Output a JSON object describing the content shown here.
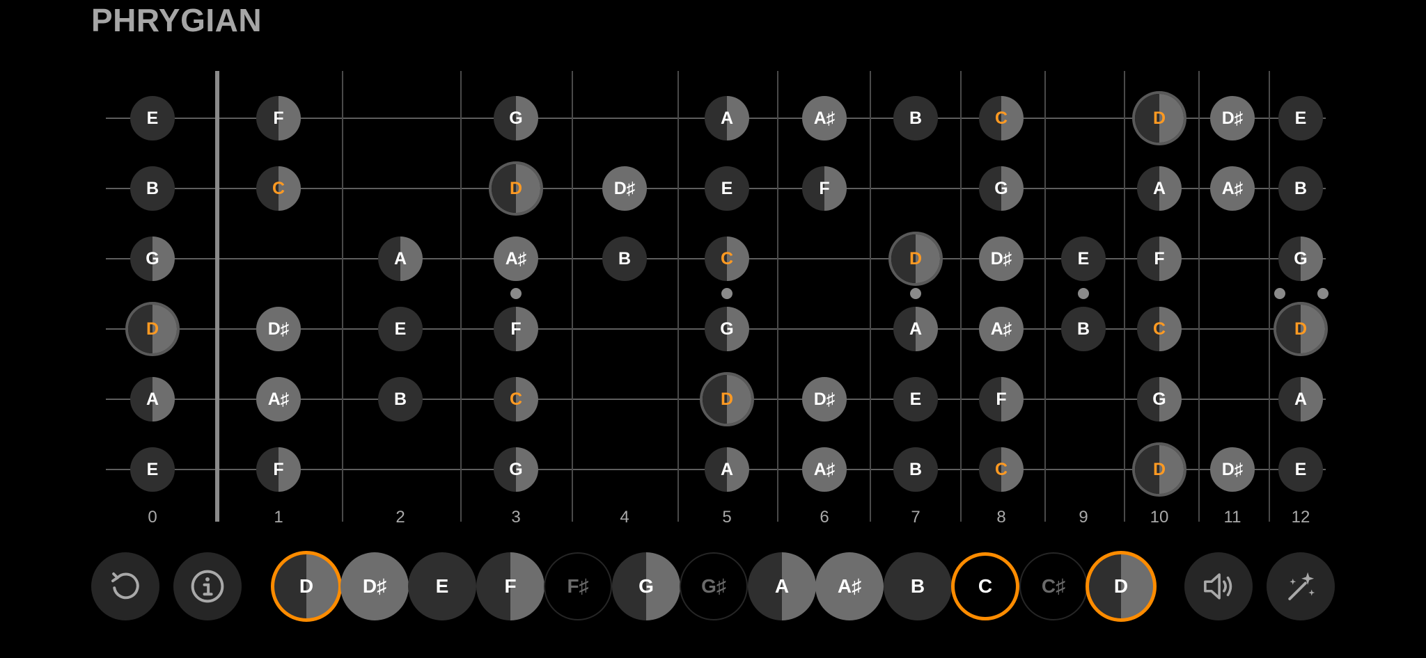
{
  "title": "PHRYGIAN",
  "colors": {
    "dark": "#2f2f2f",
    "light": "#6e6e6e",
    "accent": "#ff9a22",
    "highlight_ring": "#ff8c00"
  },
  "fret_numbers": [
    "0",
    "1",
    "2",
    "3",
    "4",
    "5",
    "6",
    "7",
    "8",
    "9",
    "10",
    "11",
    "12"
  ],
  "strings": [
    {
      "name": "high-e",
      "notes": [
        {
          "fret": 0,
          "label": "E",
          "fill": "dark"
        },
        {
          "fret": 1,
          "label": "F",
          "fill": "half"
        },
        {
          "fret": 3,
          "label": "G",
          "fill": "half"
        },
        {
          "fret": 5,
          "label": "A",
          "fill": "half"
        },
        {
          "fret": 6,
          "label": "A♯",
          "fill": "light"
        },
        {
          "fret": 7,
          "label": "B",
          "fill": "dark"
        },
        {
          "fret": 8,
          "label": "C",
          "fill": "half",
          "accent": true
        },
        {
          "fret": 10,
          "label": "D",
          "fill": "half",
          "accent": true,
          "root": true
        },
        {
          "fret": 11,
          "label": "D♯",
          "fill": "light"
        },
        {
          "fret": 12,
          "label": "E",
          "fill": "dark"
        }
      ]
    },
    {
      "name": "b",
      "notes": [
        {
          "fret": 0,
          "label": "B",
          "fill": "dark"
        },
        {
          "fret": 1,
          "label": "C",
          "fill": "half",
          "accent": true
        },
        {
          "fret": 3,
          "label": "D",
          "fill": "half",
          "accent": true,
          "root": true
        },
        {
          "fret": 4,
          "label": "D♯",
          "fill": "light"
        },
        {
          "fret": 5,
          "label": "E",
          "fill": "dark"
        },
        {
          "fret": 6,
          "label": "F",
          "fill": "half"
        },
        {
          "fret": 8,
          "label": "G",
          "fill": "half"
        },
        {
          "fret": 10,
          "label": "A",
          "fill": "half"
        },
        {
          "fret": 11,
          "label": "A♯",
          "fill": "light"
        },
        {
          "fret": 12,
          "label": "B",
          "fill": "dark"
        }
      ]
    },
    {
      "name": "g",
      "notes": [
        {
          "fret": 0,
          "label": "G",
          "fill": "half"
        },
        {
          "fret": 2,
          "label": "A",
          "fill": "half"
        },
        {
          "fret": 3,
          "label": "A♯",
          "fill": "light"
        },
        {
          "fret": 4,
          "label": "B",
          "fill": "dark"
        },
        {
          "fret": 5,
          "label": "C",
          "fill": "half",
          "accent": true
        },
        {
          "fret": 7,
          "label": "D",
          "fill": "half",
          "accent": true,
          "root": true
        },
        {
          "fret": 8,
          "label": "D♯",
          "fill": "light"
        },
        {
          "fret": 9,
          "label": "E",
          "fill": "dark"
        },
        {
          "fret": 10,
          "label": "F",
          "fill": "half"
        },
        {
          "fret": 12,
          "label": "G",
          "fill": "half"
        }
      ]
    },
    {
      "name": "d",
      "notes": [
        {
          "fret": 0,
          "label": "D",
          "fill": "half",
          "accent": true,
          "root": true
        },
        {
          "fret": 1,
          "label": "D♯",
          "fill": "light"
        },
        {
          "fret": 2,
          "label": "E",
          "fill": "dark"
        },
        {
          "fret": 3,
          "label": "F",
          "fill": "half"
        },
        {
          "fret": 5,
          "label": "G",
          "fill": "half"
        },
        {
          "fret": 7,
          "label": "A",
          "fill": "half"
        },
        {
          "fret": 8,
          "label": "A♯",
          "fill": "light"
        },
        {
          "fret": 9,
          "label": "B",
          "fill": "dark"
        },
        {
          "fret": 10,
          "label": "C",
          "fill": "half",
          "accent": true
        },
        {
          "fret": 12,
          "label": "D",
          "fill": "half",
          "accent": true,
          "root": true
        }
      ]
    },
    {
      "name": "a",
      "notes": [
        {
          "fret": 0,
          "label": "A",
          "fill": "half"
        },
        {
          "fret": 1,
          "label": "A♯",
          "fill": "light"
        },
        {
          "fret": 2,
          "label": "B",
          "fill": "dark"
        },
        {
          "fret": 3,
          "label": "C",
          "fill": "half",
          "accent": true
        },
        {
          "fret": 5,
          "label": "D",
          "fill": "half",
          "accent": true,
          "root": true
        },
        {
          "fret": 6,
          "label": "D♯",
          "fill": "light"
        },
        {
          "fret": 7,
          "label": "E",
          "fill": "dark"
        },
        {
          "fret": 8,
          "label": "F",
          "fill": "half"
        },
        {
          "fret": 10,
          "label": "G",
          "fill": "half"
        },
        {
          "fret": 12,
          "label": "A",
          "fill": "half"
        }
      ]
    },
    {
      "name": "low-e",
      "notes": [
        {
          "fret": 0,
          "label": "E",
          "fill": "dark"
        },
        {
          "fret": 1,
          "label": "F",
          "fill": "half"
        },
        {
          "fret": 3,
          "label": "G",
          "fill": "half"
        },
        {
          "fret": 5,
          "label": "A",
          "fill": "half"
        },
        {
          "fret": 6,
          "label": "A♯",
          "fill": "light"
        },
        {
          "fret": 7,
          "label": "B",
          "fill": "dark"
        },
        {
          "fret": 8,
          "label": "C",
          "fill": "half",
          "accent": true
        },
        {
          "fret": 10,
          "label": "D",
          "fill": "half",
          "accent": true,
          "root": true
        },
        {
          "fret": 11,
          "label": "D♯",
          "fill": "light"
        },
        {
          "fret": 12,
          "label": "E",
          "fill": "dark"
        }
      ]
    }
  ],
  "scale_buttons": [
    {
      "label": "D",
      "fill": "half",
      "highlight": true
    },
    {
      "label": "D♯",
      "fill": "light"
    },
    {
      "label": "E",
      "fill": "dark"
    },
    {
      "label": "F",
      "fill": "half"
    },
    {
      "label": "F♯",
      "fill": "off"
    },
    {
      "label": "G",
      "fill": "half"
    },
    {
      "label": "G♯",
      "fill": "off"
    },
    {
      "label": "A",
      "fill": "half"
    },
    {
      "label": "A♯",
      "fill": "light"
    },
    {
      "label": "B",
      "fill": "dark"
    },
    {
      "label": "C",
      "fill": "off",
      "highlight": true,
      "active": true
    },
    {
      "label": "C♯",
      "fill": "off"
    },
    {
      "label": "D",
      "fill": "half",
      "highlight": true
    }
  ],
  "controls": {
    "reset": "reset-icon",
    "info": "info-icon",
    "sound": "speaker-icon",
    "magic": "magic-wand-icon"
  }
}
